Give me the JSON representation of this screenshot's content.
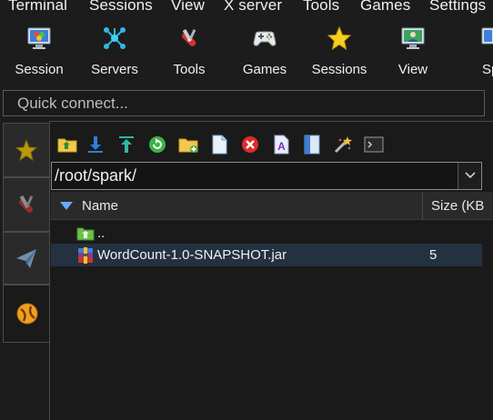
{
  "menubar": {
    "items": [
      "Terminal",
      "Sessions",
      "View",
      "X server",
      "Tools",
      "Games",
      "Settings"
    ]
  },
  "toolbar": {
    "buttons": [
      {
        "label": "Session",
        "icon": "session-monitor-icon"
      },
      {
        "label": "Servers",
        "icon": "servers-network-icon"
      },
      {
        "label": "Tools",
        "icon": "tools-knife-icon"
      },
      {
        "label": "Games",
        "icon": "gamepad-icon"
      },
      {
        "label": "Sessions",
        "icon": "star-icon"
      },
      {
        "label": "View",
        "icon": "view-monitor-icon"
      },
      {
        "label": "Sp",
        "icon": "split-icon"
      }
    ]
  },
  "quick_connect": {
    "placeholder": "Quick connect..."
  },
  "side_tabs": [
    {
      "icon": "star-icon"
    },
    {
      "icon": "tools-knife-icon"
    },
    {
      "icon": "paper-plane-icon"
    },
    {
      "icon": "sftp-globe-icon"
    }
  ],
  "file_toolbar": [
    "parent-folder-icon",
    "download-icon",
    "upload-icon",
    "refresh-icon",
    "new-folder-icon",
    "new-file-icon",
    "delete-icon",
    "rename-icon",
    "properties-icon",
    "magic-wand-icon",
    "terminal-icon"
  ],
  "path": {
    "value": "/root/spark/"
  },
  "file_list": {
    "columns": {
      "name": "Name",
      "size": "Size (KB"
    },
    "rows": [
      {
        "name": "..",
        "size": "",
        "icon": "parent-folder-icon"
      },
      {
        "name": "WordCount-1.0-SNAPSHOT.jar",
        "size": "5",
        "icon": "jar-archive-icon"
      }
    ]
  },
  "colors": {
    "background": "#1c1c1c",
    "panel": "#1a1a1a",
    "selected_row": "#243140",
    "accent_blue": "#3f8ee8"
  }
}
